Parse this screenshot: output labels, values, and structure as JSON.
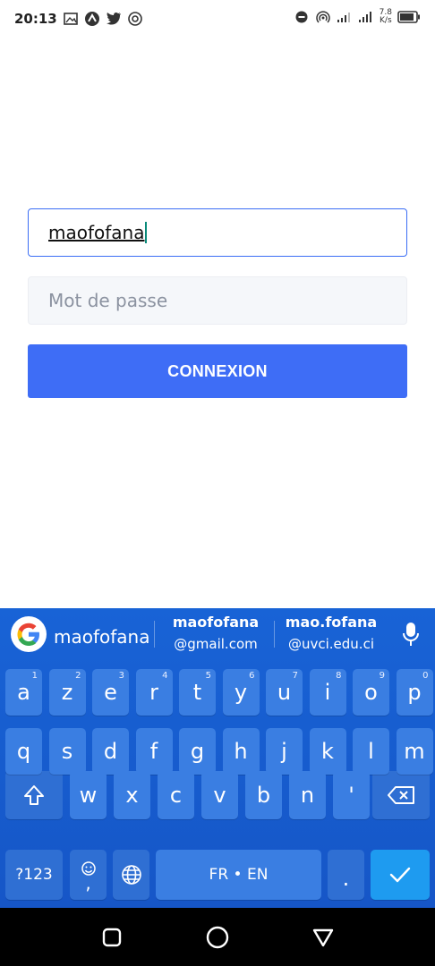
{
  "status_bar": {
    "time": "20:13",
    "net_speed_value": "7.8",
    "net_speed_unit": "K/s",
    "icons_left": [
      "image-icon",
      "app-icon",
      "twitter-icon",
      "cast-icon"
    ],
    "icons_right": [
      "dnd-icon",
      "hotspot-icon",
      "signal-icon",
      "signal2-icon",
      "battery-icon"
    ]
  },
  "login": {
    "username_value": "maofofana",
    "password_placeholder": "Mot de passe",
    "submit_label": "CONNEXION",
    "accent_color": "#3e6df6"
  },
  "keyboard": {
    "suggestions": {
      "first": "maofofana",
      "second_main": "maofofana",
      "second_sub": "@gmail.com",
      "third_main": "mao.fofana",
      "third_sub": "@uvci.edu.ci"
    },
    "row1": [
      {
        "k": "a",
        "n": "1"
      },
      {
        "k": "z",
        "n": "2"
      },
      {
        "k": "e",
        "n": "3"
      },
      {
        "k": "r",
        "n": "4"
      },
      {
        "k": "t",
        "n": "5"
      },
      {
        "k": "y",
        "n": "6"
      },
      {
        "k": "u",
        "n": "7"
      },
      {
        "k": "i",
        "n": "8"
      },
      {
        "k": "o",
        "n": "9"
      },
      {
        "k": "p",
        "n": "0"
      }
    ],
    "row2": [
      "q",
      "s",
      "d",
      "f",
      "g",
      "h",
      "j",
      "k",
      "l",
      "m"
    ],
    "row3": [
      "w",
      "x",
      "c",
      "v",
      "b",
      "n",
      "'"
    ],
    "symbols_label": "?123",
    "comma": ",",
    "language_label": "FR • EN",
    "period": "."
  },
  "nav_bar": {
    "buttons": [
      "recents-icon",
      "home-icon",
      "back-icon"
    ]
  }
}
